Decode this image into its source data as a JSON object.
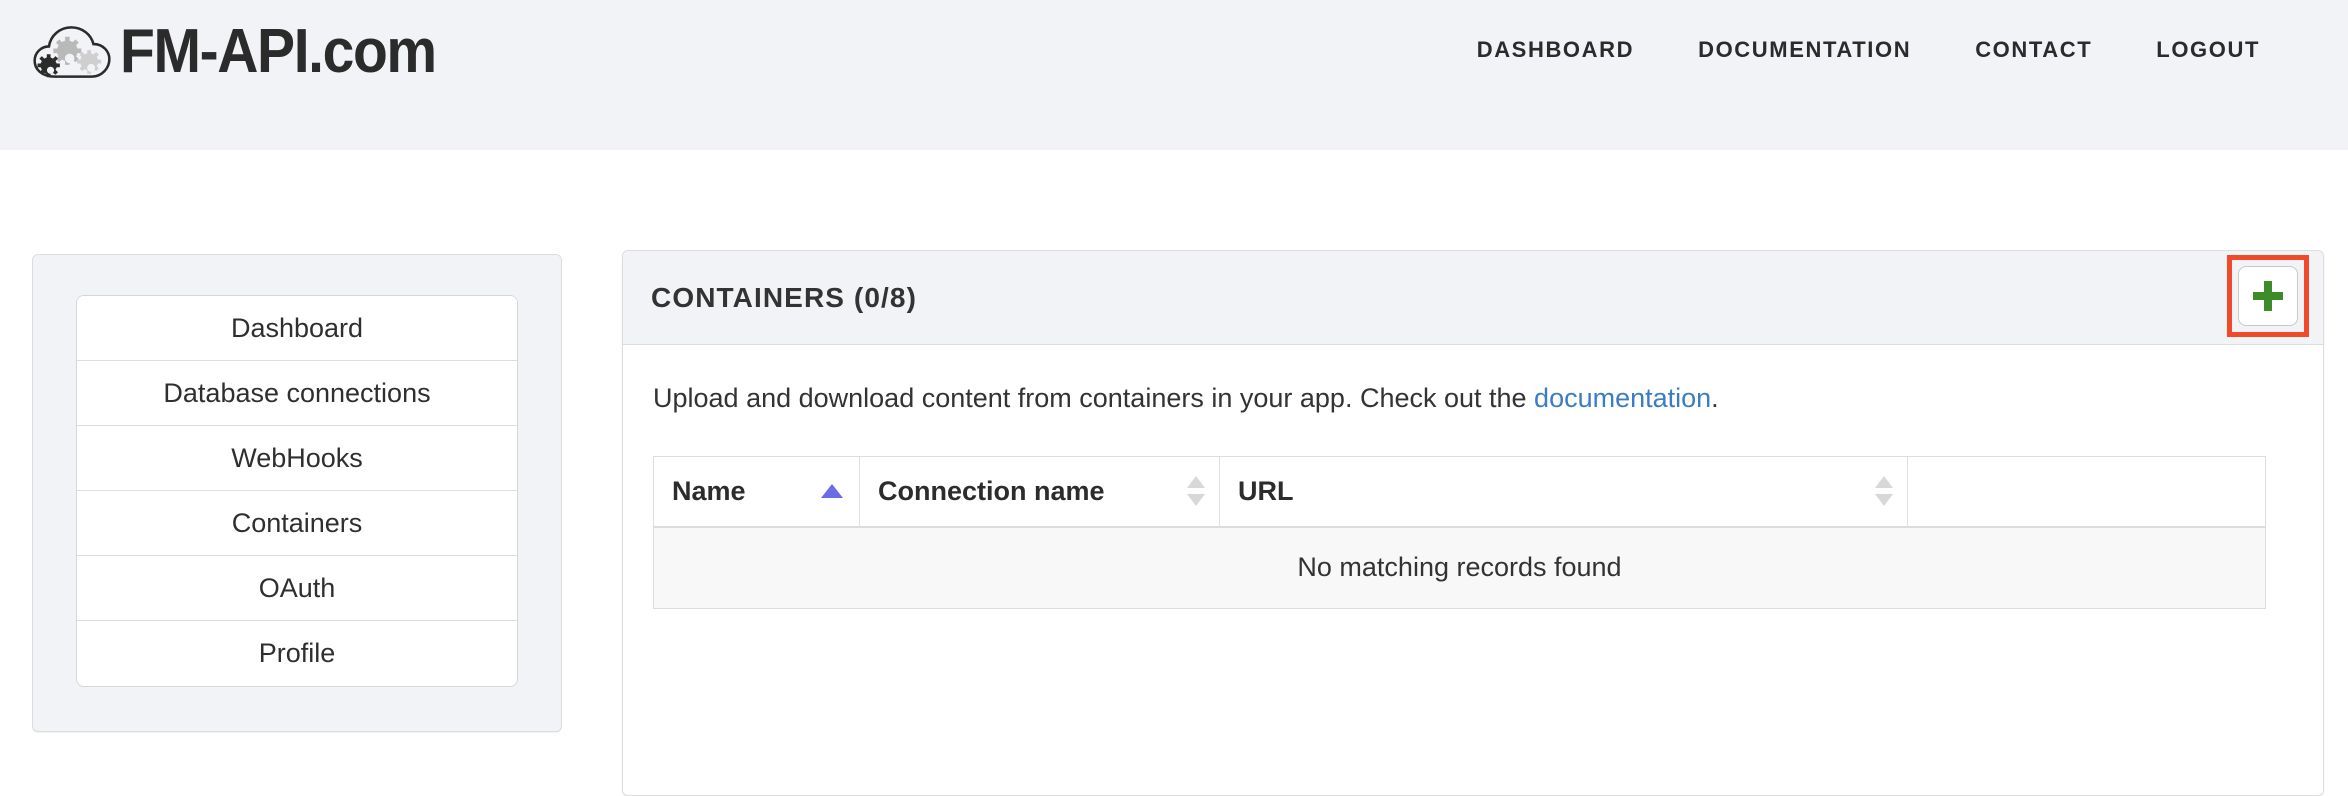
{
  "navbar": {
    "brand": {
      "logo_icon": "cloud-gears-logo",
      "text": "FM-API.com"
    },
    "links": [
      {
        "label": "DASHBOARD",
        "name": "nav-link-dashboard"
      },
      {
        "label": "DOCUMENTATION",
        "name": "nav-link-documentation"
      },
      {
        "label": "CONTACT",
        "name": "nav-link-contact"
      },
      {
        "label": "LOGOUT",
        "name": "nav-link-logout"
      }
    ]
  },
  "sidebar": {
    "items": [
      {
        "label": "Dashboard"
      },
      {
        "label": "Database connections"
      },
      {
        "label": "WebHooks"
      },
      {
        "label": "Containers"
      },
      {
        "label": "OAuth"
      },
      {
        "label": "Profile"
      }
    ]
  },
  "main": {
    "panel_title": "CONTAINERS (0/8)",
    "add_button": {
      "icon": "plus-icon",
      "label": "+",
      "highlight_color": "#ef4a2a",
      "icon_color": "#3c8c29"
    },
    "description": {
      "before_link": "Upload and download content from containers in your app. Check out the ",
      "link_text": "documentation",
      "after_link": "."
    },
    "table": {
      "columns": [
        {
          "label": "Name",
          "sort": "asc-active"
        },
        {
          "label": "Connection name",
          "sort": "both"
        },
        {
          "label": "URL",
          "sort": "both"
        },
        {
          "label": "",
          "sort": "none"
        }
      ],
      "rows": [],
      "empty_message": "No matching records found"
    }
  },
  "colors": {
    "navbar_bg": "#f2f3f6",
    "panel_heading_bg": "#f2f3f6",
    "link_blue": "#3b7dc4",
    "sort_active": "#6c6ce8",
    "plus_green": "#3c8c29",
    "highlight_red": "#ef4a2a"
  }
}
